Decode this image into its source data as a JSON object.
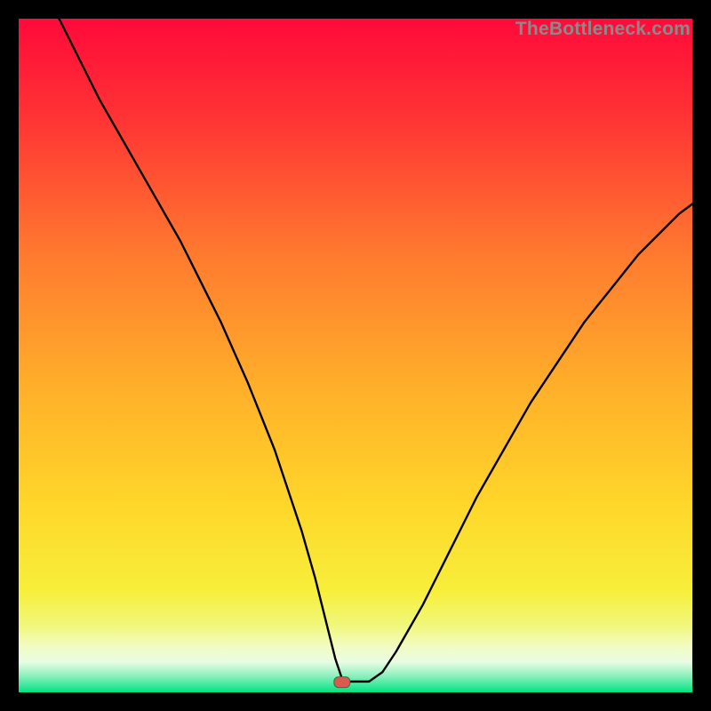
{
  "watermark": "TheBottleneck.com",
  "colors": {
    "frame": "#000000",
    "curve_stroke": "#000000",
    "marker_fill": "#d95b4f",
    "marker_stroke": "#2b7a3a",
    "gradient_stops": [
      {
        "offset": 0.0,
        "color": "#ff0a3a"
      },
      {
        "offset": 0.15,
        "color": "#ff3434"
      },
      {
        "offset": 0.35,
        "color": "#ff7a2f"
      },
      {
        "offset": 0.55,
        "color": "#ffb02a"
      },
      {
        "offset": 0.72,
        "color": "#ffd62a"
      },
      {
        "offset": 0.85,
        "color": "#f7ef3a"
      },
      {
        "offset": 0.9,
        "color": "#f1f77a"
      },
      {
        "offset": 0.93,
        "color": "#f3fbc0"
      },
      {
        "offset": 0.955,
        "color": "#e8fde2"
      },
      {
        "offset": 0.975,
        "color": "#8ff0bf"
      },
      {
        "offset": 1.0,
        "color": "#00e380"
      }
    ]
  },
  "chart_data": {
    "type": "line",
    "title": "",
    "xlabel": "",
    "ylabel": "",
    "xlim": [
      0,
      100
    ],
    "ylim": [
      0,
      100
    ],
    "grid": false,
    "legend": false,
    "marker": {
      "x": 48,
      "y": 1.5,
      "shape": "rounded-rect"
    },
    "x": [
      6,
      8,
      10,
      12,
      14,
      16,
      18,
      20,
      22,
      24,
      26,
      28,
      30,
      32,
      34,
      36,
      38,
      40,
      42,
      44,
      45,
      46,
      47,
      48,
      49,
      50,
      52,
      54,
      56,
      58,
      60,
      62,
      64,
      66,
      68,
      70,
      72,
      74,
      76,
      78,
      80,
      82,
      84,
      86,
      88,
      90,
      92,
      94,
      96,
      98,
      100
    ],
    "values": [
      100,
      96,
      92,
      88,
      84.5,
      81,
      77.5,
      74,
      70.5,
      67,
      63,
      59,
      55,
      50.5,
      46,
      41,
      36,
      30,
      24,
      17,
      13,
      9,
      5,
      2,
      1.6,
      1.6,
      1.6,
      3,
      6,
      9.5,
      13,
      17,
      21,
      25,
      29,
      32.5,
      36,
      39.5,
      43,
      46,
      49,
      52,
      55,
      57.5,
      60,
      62.5,
      65,
      67,
      69,
      71,
      72.5
    ],
    "baseline_segment": {
      "x_start": 45.5,
      "x_end": 53,
      "y": 1.55
    }
  }
}
